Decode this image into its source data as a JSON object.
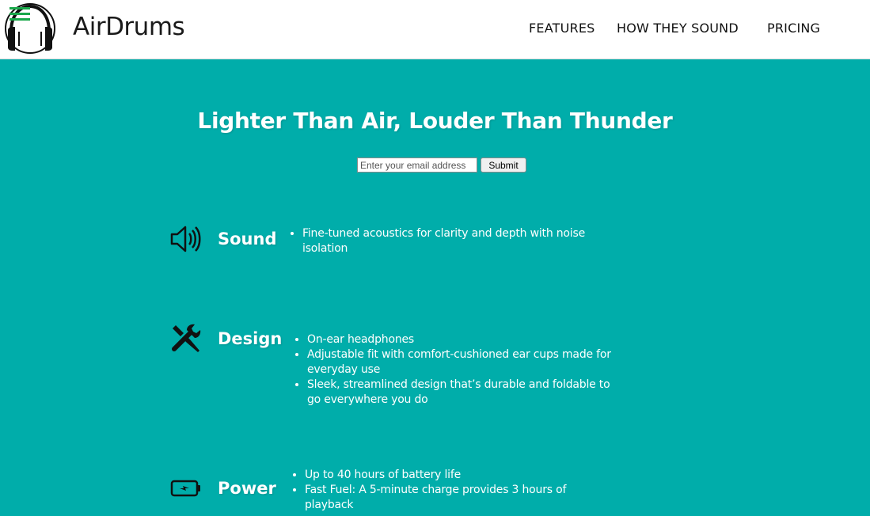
{
  "header": {
    "brand": "AirDrums",
    "logo_icon": "headphones-logo-icon",
    "menu_icon": "hamburger-menu-icon",
    "nav": [
      {
        "label": "FEATURES"
      },
      {
        "label": "HOW THEY SOUND"
      },
      {
        "label": "PRICING"
      }
    ]
  },
  "hero": {
    "title": "Lighter Than Air, Louder Than Thunder",
    "email_placeholder": "Enter your email address",
    "submit_label": "Submit"
  },
  "features": [
    {
      "icon": "speaker-volume-icon",
      "title": "Sound",
      "bullets": [
        "Fine-tuned acoustics for clarity and depth with noise isolation"
      ]
    },
    {
      "icon": "tools-icon",
      "title": "Design",
      "bullets": [
        "On-ear headphones",
        "Adjustable fit with comfort-cushioned ear cups made for everyday use",
        "Sleek, streamlined design that’s durable and foldable to go everywhere you do"
      ]
    },
    {
      "icon": "battery-charging-icon",
      "title": "Power",
      "bullets": [
        "Up to 40 hours of battery life",
        "Fast Fuel: A 5-minute charge provides 3 hours of playback"
      ]
    }
  ],
  "colors": {
    "background": "#00adaa",
    "header_bg": "#ffffff",
    "menu_icon": "#1aa84b"
  }
}
